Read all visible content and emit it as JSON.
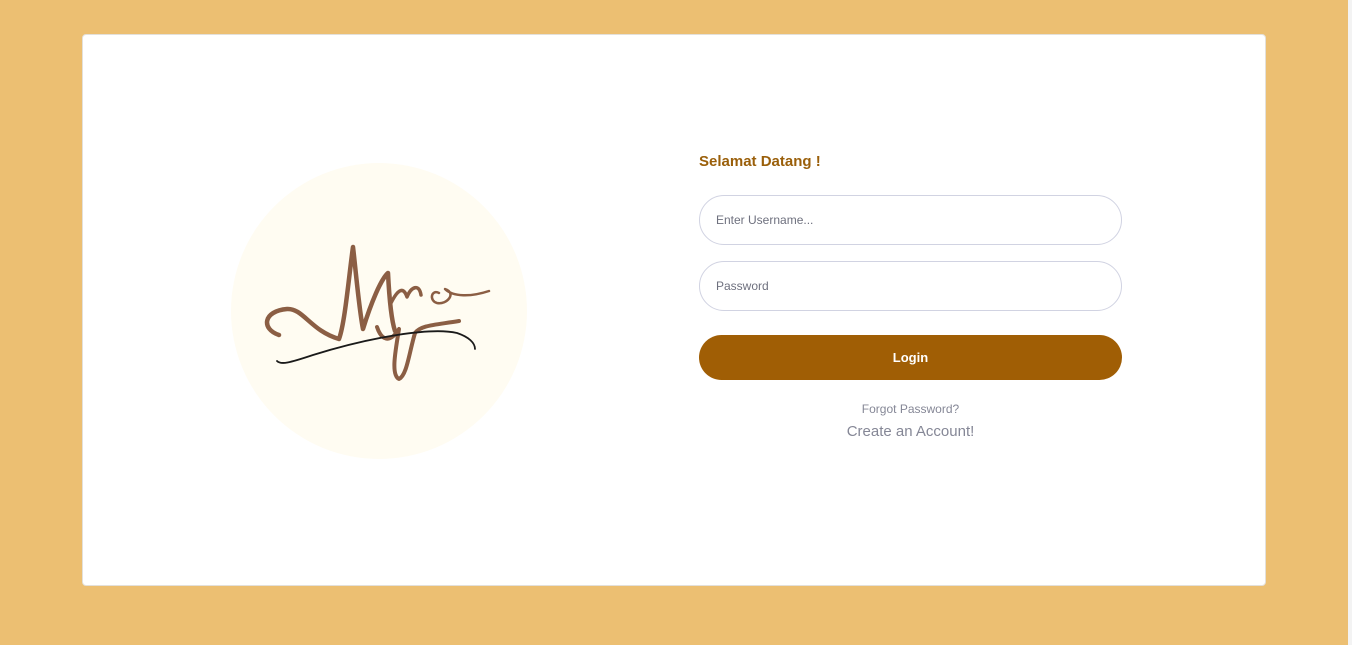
{
  "brand": {
    "logo_text": "Myo",
    "colors": {
      "page_background": "#ecbf72",
      "accent": "#a05e05",
      "greeting": "#9a5f0a",
      "logo_ink": "#8b5e44",
      "logo_circle": "#fffcf2"
    }
  },
  "login": {
    "greeting": "Selamat Datang !",
    "username_placeholder": "Enter Username...",
    "password_placeholder": "Password",
    "login_label": "Login",
    "forgot_password": "Forgot Password?",
    "create_account": "Create an Account!"
  }
}
